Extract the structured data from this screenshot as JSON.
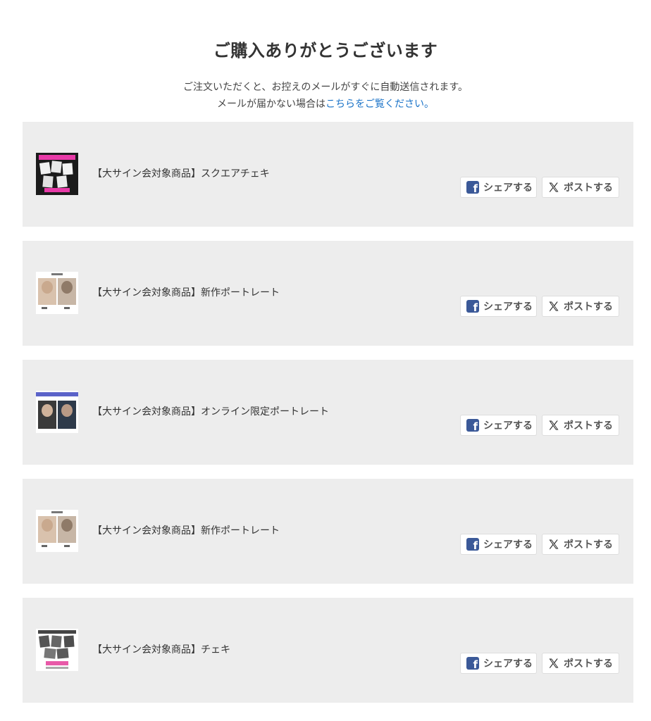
{
  "header": {
    "title": "ご購入ありがとうございます",
    "notice_line1": "ご注文いただくと、お控えのメールがすぐに自動送信されます。",
    "notice_line2_prefix": "メールが届かない場合は",
    "notice_line2_link": "こちらをご覧ください。"
  },
  "share": {
    "facebook_label": "シェアする",
    "x_label": "ポストする",
    "facebook_icon": "facebook-icon",
    "x_icon": "x-logo-icon"
  },
  "colors": {
    "card_background": "#ededed",
    "link": "#1a73c8",
    "facebook": "#3b5998"
  },
  "orders": [
    {
      "name": "【大サイン会対象商品】スクエアチェキ",
      "thumb": "square-cheki"
    },
    {
      "name": "【大サイン会対象商品】新作ポートレート",
      "thumb": "portrait"
    },
    {
      "name": "【大サイン会対象商品】オンライン限定ポートレート",
      "thumb": "online-portrait"
    },
    {
      "name": "【大サイン会対象商品】新作ポートレート",
      "thumb": "portrait"
    },
    {
      "name": "【大サイン会対象商品】チェキ",
      "thumb": "cheki"
    }
  ]
}
